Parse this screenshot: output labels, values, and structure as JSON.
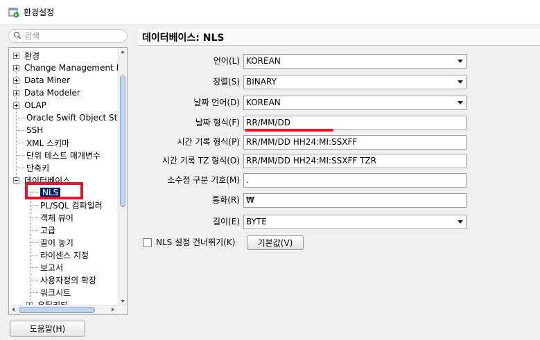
{
  "window": {
    "title": "환경설정"
  },
  "search": {
    "placeholder": "검색"
  },
  "tree": {
    "items": [
      {
        "label": "환경"
      },
      {
        "label": "Change Management D"
      },
      {
        "label": "Data Miner"
      },
      {
        "label": "Data Modeler"
      },
      {
        "label": "OLAP"
      },
      {
        "label": "Oracle Swift Object Sto"
      },
      {
        "label": "SSH"
      },
      {
        "label": "XML 스키마"
      },
      {
        "label": "단위 테스트 매개변수"
      },
      {
        "label": "단축키"
      },
      {
        "label": "데이터베이스"
      },
      {
        "label": "NLS"
      },
      {
        "label": "PL/SQL 컴파일러"
      },
      {
        "label": "객체 뷰어"
      },
      {
        "label": "고급"
      },
      {
        "label": "끌어 놓기"
      },
      {
        "label": "라이센스 지정"
      },
      {
        "label": "보고서"
      },
      {
        "label": "사용자정의 확장"
      },
      {
        "label": "워크시트"
      },
      {
        "label": "유틸리티"
      }
    ]
  },
  "help_button": {
    "label": "도움말(H)"
  },
  "panel": {
    "title": "데이터베이스: NLS"
  },
  "form": {
    "language": {
      "label": "언어(L)",
      "value": "KOREAN"
    },
    "sort": {
      "label": "정렬(S)",
      "value": "BINARY"
    },
    "date_language": {
      "label": "날짜 언어(D)",
      "value": "KOREAN"
    },
    "date_format": {
      "label": "날짜 형식(F)",
      "value": "RR/MM/DD"
    },
    "timestamp_format": {
      "label": "시간 기록 형식(P)",
      "value": "RR/MM/DD HH24:MI:SSXFF"
    },
    "timestamp_tz_format": {
      "label": "시간 기록 TZ 형식(O)",
      "value": "RR/MM/DD HH24:MI:SSXFF TZR"
    },
    "decimal_separator": {
      "label": "소수점 구분 기호(M)",
      "value": "."
    },
    "currency": {
      "label": "통화(R)",
      "value": "₩"
    },
    "length": {
      "label": "길이(E)",
      "value": "BYTE"
    },
    "skip_nls": {
      "label": "NLS 설정 건너뛰기(K)"
    },
    "default_button": {
      "label": "기본값(V)"
    }
  }
}
